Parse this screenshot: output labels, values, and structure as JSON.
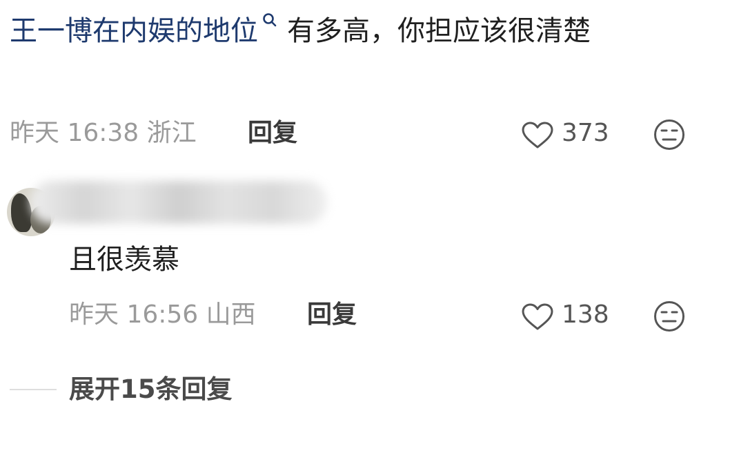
{
  "comment": {
    "highlight_text": "王一博在内娱的地位",
    "text_rest": "有多高，你担应该很清楚",
    "meta": "昨天 16:38 浙江",
    "reply_label": "回复",
    "like_count": "373"
  },
  "reply": {
    "text": "且很羡慕",
    "meta": "昨天 16:56 山西",
    "reply_label": "回复",
    "like_count": "138"
  },
  "expand_label": "展开15条回复"
}
